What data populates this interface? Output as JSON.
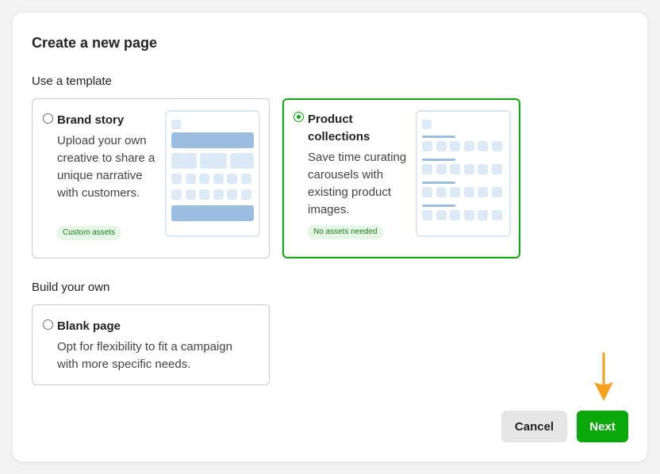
{
  "dialog": {
    "title": "Create a new page",
    "template_section_label": "Use a template",
    "build_section_label": "Build your own"
  },
  "templates": [
    {
      "title": "Brand story",
      "description": "Upload your own creative to share a unique narrative with customers.",
      "badge": "Custom assets",
      "selected": false
    },
    {
      "title": "Product collections",
      "description": "Save time curating carousels with existing product images.",
      "badge": "No assets needed",
      "selected": true
    }
  ],
  "blank": {
    "title": "Blank page",
    "description": "Opt for flexibility to fit a campaign with more specific needs.",
    "selected": false
  },
  "footer": {
    "cancel_label": "Cancel",
    "next_label": "Next"
  },
  "colors": {
    "accent": "#0aa80a",
    "annotation_arrow": "#f5a01e",
    "preview_block": "#9bbde0",
    "preview_block_light": "#dce9f7"
  }
}
